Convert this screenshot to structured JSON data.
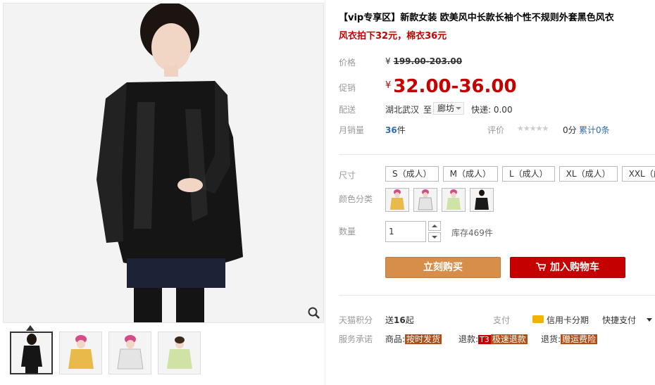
{
  "product": {
    "title": "【vip专享区】新款女装 欧美风中长款长袖个性不规则外套黑色风衣",
    "subtitle": "风衣拍下32元，棉衣36元"
  },
  "price": {
    "label": "价格",
    "currency": "¥",
    "original": "199.00-203.00",
    "promo_label": "促销",
    "promo": "32.00-36.00"
  },
  "shipping": {
    "label": "配送",
    "from": "湖北武汉",
    "to_label": "至",
    "to": "廊坊",
    "fee": "快递: 0.00"
  },
  "sales": {
    "label": "月销量",
    "count": "36",
    "unit": "件",
    "rating_label": "评价",
    "stars": "★★★★★",
    "score": "0分",
    "review_link": "累计0条"
  },
  "options": {
    "size_label": "尺寸",
    "sizes": [
      "S（成人）",
      "M（成人）",
      "L（成人）",
      "XL（成人）",
      "XXL（成人）"
    ],
    "color_label": "颜色分类",
    "colors": [
      "#e9b94a",
      "#e4e4e4",
      "#cfe3a6",
      "#1a1a1a"
    ]
  },
  "quantity": {
    "label": "数量",
    "value": "1",
    "stock": "库存469件"
  },
  "buttons": {
    "buy_now": "立刻购买",
    "add_cart": "加入购物车"
  },
  "points": {
    "label": "天猫积分",
    "prefix": "送",
    "value": "16",
    "suffix": "起"
  },
  "payment": {
    "label": "支付",
    "card": "信用卡分期",
    "quick": "快捷支付"
  },
  "service": {
    "label": "服务承诺",
    "goods_prefix": "商品:",
    "goods_tag": "按时发货",
    "refund_prefix": "退款:",
    "refund_badge": "T3",
    "refund_tag": "极速退款",
    "return_prefix": "退货:",
    "return_tag": "赠运费险"
  },
  "colors": {
    "accent_red": "#c40000",
    "buy_orange": "#d88e4b",
    "link_blue": "#2f6cb3"
  }
}
